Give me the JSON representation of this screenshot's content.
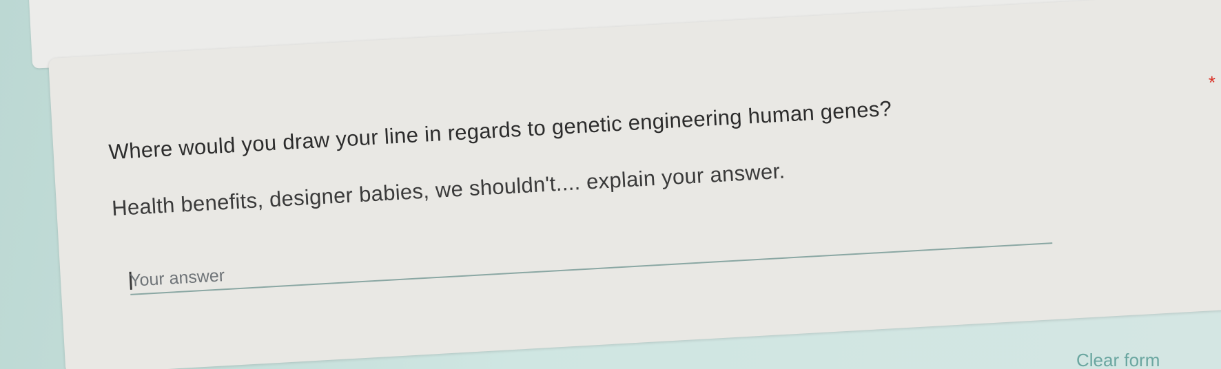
{
  "question": {
    "line1": "Where would you draw your line in regards to genetic engineering human genes?",
    "line2": "Health benefits, designer babies, we shouldn't.... explain your answer.",
    "required_marker": "*"
  },
  "answer": {
    "placeholder": "Your answer",
    "value": ""
  },
  "footer": {
    "clear_label": "Clear form"
  },
  "colors": {
    "required": "#d93025",
    "accent": "#6aa6a0",
    "background": "#c9e0dc",
    "card": "#e9e8e4"
  }
}
